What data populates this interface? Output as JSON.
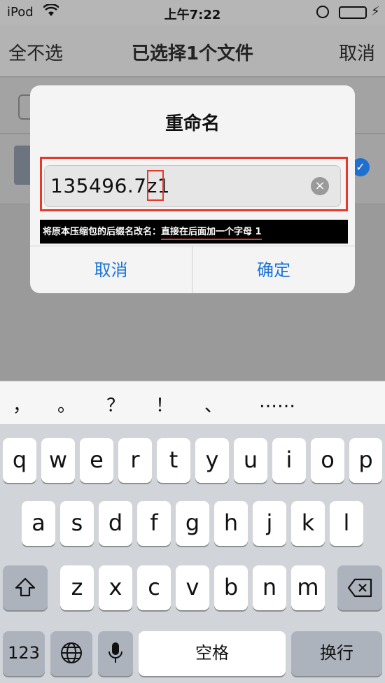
{
  "status": {
    "carrier": "iPod",
    "time": "上午7:22"
  },
  "nav": {
    "left": "全不选",
    "title": "已选择1个文件",
    "right": "取消"
  },
  "dialog": {
    "title": "重命名",
    "field_value": "135496.7z1",
    "hint_prefix": "将原本压缩包的后缀名改名：",
    "hint_emphasis": "直接在后面加一个字母 1",
    "cancel": "取消",
    "confirm": "确定"
  },
  "suggestions": [
    "，",
    "。",
    "？",
    "！",
    "、",
    "……"
  ],
  "keyboard": {
    "row1": [
      "q",
      "w",
      "e",
      "r",
      "t",
      "y",
      "u",
      "i",
      "o",
      "p"
    ],
    "row2": [
      "a",
      "s",
      "d",
      "f",
      "g",
      "h",
      "j",
      "k",
      "l"
    ],
    "row3": [
      "z",
      "x",
      "c",
      "v",
      "b",
      "n",
      "m"
    ],
    "numbers": "123",
    "space": "空格",
    "return": "换行"
  },
  "colors": {
    "accent": "#1a73d9",
    "highlight": "#e53a2b",
    "battery": "#5cc75c"
  }
}
